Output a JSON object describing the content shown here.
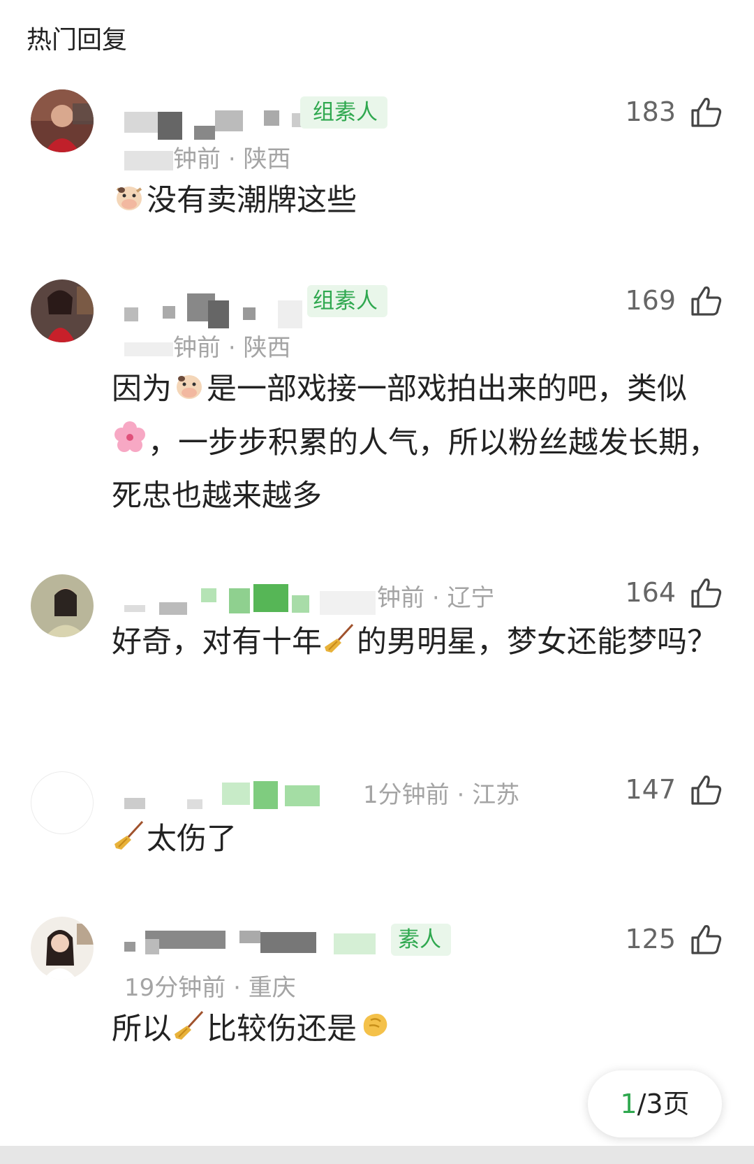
{
  "section_title": "热门回复",
  "comments": [
    {
      "badge": "组素人",
      "time": "钟前",
      "dot": "·",
      "location": "陕西",
      "likes": "183",
      "text_parts": [
        "没有卖潮牌这些"
      ]
    },
    {
      "badge": "组素人",
      "time": "钟前",
      "dot": "·",
      "location": "陕西",
      "likes": "169",
      "text_parts": [
        "因为",
        "是一部戏接一部戏拍出来的吧，类似",
        "，一步步积累的人气，所以粉丝越发长期，死忠也越来越多"
      ]
    },
    {
      "time": "钟前",
      "dot": "·",
      "location": "辽宁",
      "likes": "164",
      "text_parts": [
        "好奇，对有十年",
        "的男明星，梦女还能梦吗？"
      ]
    },
    {
      "time": "1分钟前",
      "dot": "·",
      "location": "江苏",
      "likes": "147",
      "text_parts": [
        "太伤了"
      ]
    },
    {
      "badge": "素人",
      "time": "19分钟前",
      "dot": "·",
      "location": "重庆",
      "likes": "125",
      "text_parts": [
        "所以",
        "比较伤还是"
      ]
    }
  ],
  "pager": {
    "current": "1",
    "total": "/3页"
  },
  "icons": [
    "cow-face-icon",
    "cherry-blossom-icon",
    "broom-icon",
    "pinching-hand-icon",
    "thumbs-up-icon"
  ],
  "colors": {
    "accent": "#2fa84f",
    "badge_bg": "#e9f6ea",
    "meta": "#a4a4a4"
  }
}
